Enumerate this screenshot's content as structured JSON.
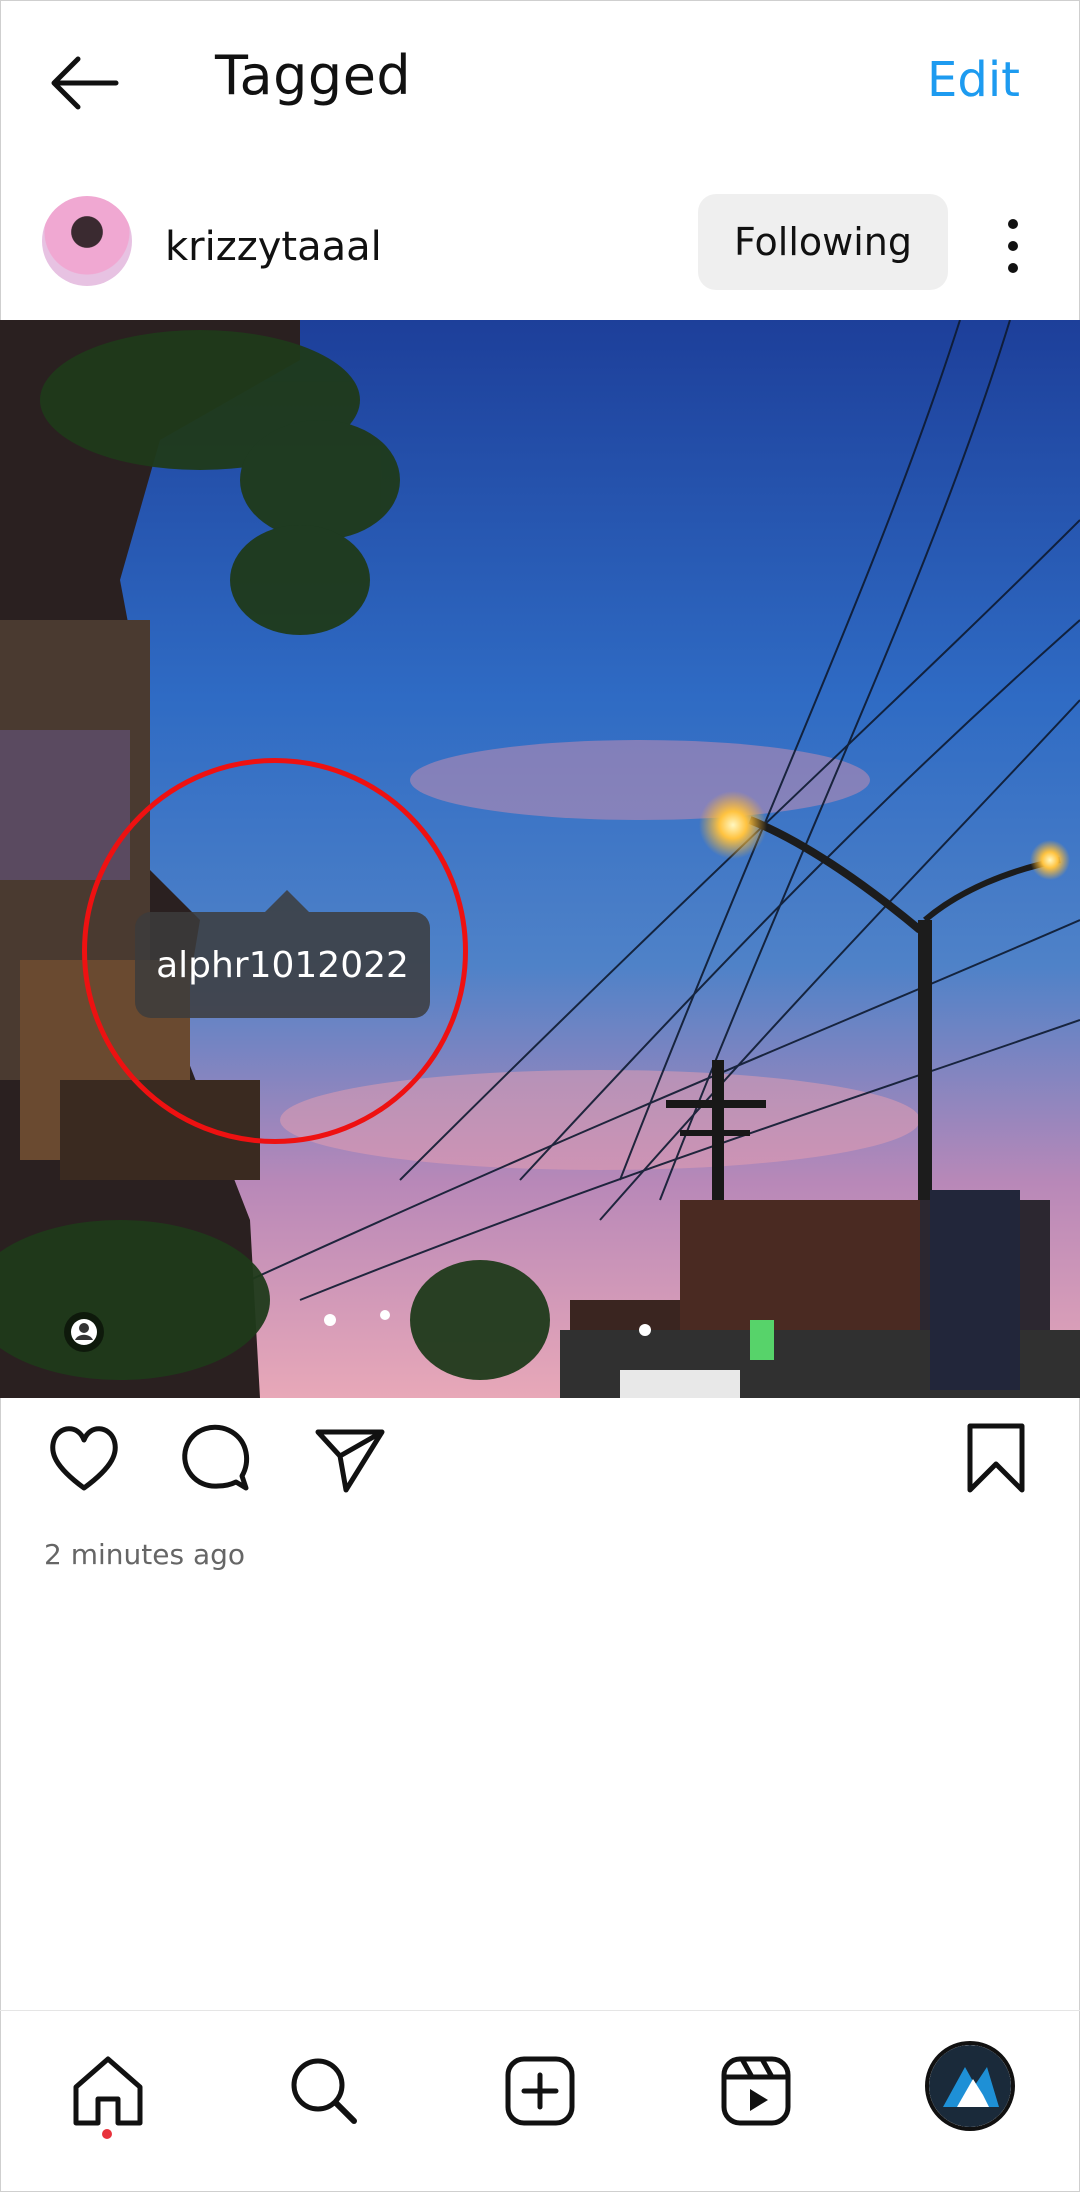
{
  "header": {
    "title": "Tagged",
    "edit_label": "Edit"
  },
  "post": {
    "username": "krizzytaaal",
    "following_label": "Following",
    "tag_label": "alphr1012022",
    "timestamp": "2 minutes ago"
  },
  "icons": {
    "back": "arrow-left-icon",
    "more": "vertical-ellipsis-icon",
    "like": "heart-icon",
    "comment": "speech-bubble-icon",
    "share": "paper-plane-icon",
    "save": "bookmark-icon",
    "home": "home-icon",
    "search": "search-icon",
    "create": "plus-square-icon",
    "reels": "reels-icon"
  },
  "colors": {
    "accent": "#1d9bf0",
    "highlight": "#e11111",
    "notification": "#e8323c"
  }
}
